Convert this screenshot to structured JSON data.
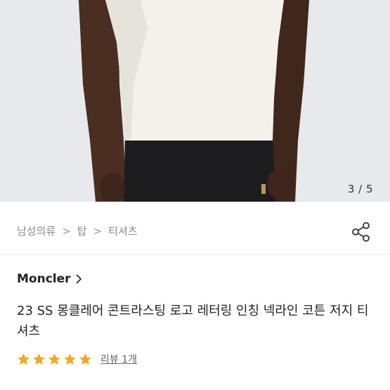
{
  "image": {
    "counter": "3 / 5",
    "colors": {
      "background": "#e8e9ec",
      "shirt": "#f3f1ea",
      "skin": "#4a2e22",
      "pants": "#1c1c1f"
    }
  },
  "breadcrumb": {
    "items": [
      "남성의류",
      "탑",
      "티셔츠"
    ],
    "separator": ">"
  },
  "share_icon": "share-icon",
  "brand": {
    "name": "Moncler"
  },
  "product": {
    "title": "23 SS 몽클레어 콘트라스팅 로고 레터링 인칭 넥라인 코튼 저지 티셔츠"
  },
  "rating": {
    "stars": 5,
    "star_color": "#f5a623",
    "reviews_label": "리뷰 1개"
  }
}
